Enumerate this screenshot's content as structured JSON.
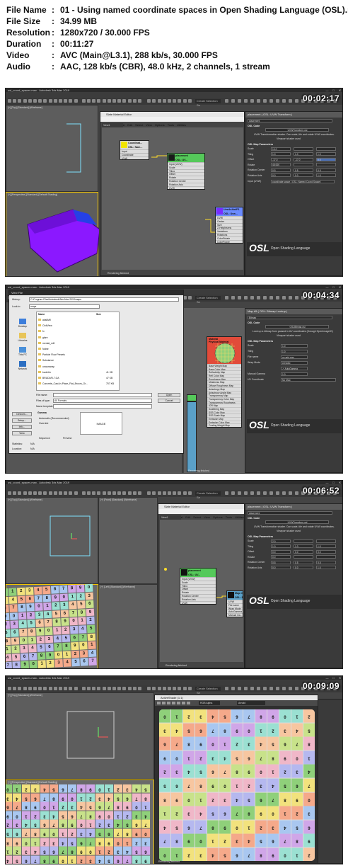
{
  "info": {
    "rows": [
      {
        "key": "File Name",
        "value": "01 - Using named coordinate spaces in Open Shading Language (OSL).mp4"
      },
      {
        "key": "File Size",
        "value": "34.99 MB"
      },
      {
        "key": "Resolution",
        "value": "1280x720 / 30.000 FPS"
      },
      {
        "key": "Duration",
        "value": "00:11:27"
      },
      {
        "key": "Video",
        "value": "AVC (Main@L3.1), 288 kb/s, 30.000 FPS"
      },
      {
        "key": "Audio",
        "value": "AAC, 128 kb/s (CBR), 48.0 kHz, 2 channels, 1 stream"
      }
    ],
    "colon": ":"
  },
  "window_title": "osl_coord_spaces.max - Autodesk 3ds Max 2019",
  "window_buttons": [
    "—",
    "□",
    "✕"
  ],
  "menu": [
    "File",
    "Edit",
    "Tools",
    "Group",
    "Views",
    "Create",
    "Modifiers",
    "Animation",
    "Graph Editors",
    "Rendering",
    "Civil View",
    "Customize",
    "Scripting",
    "Content"
  ],
  "signin": "Sign In",
  "selection_set": "Create Selection Se",
  "branding": {
    "linkedin": "Linked",
    "in": "in",
    "learning": "LEARNING",
    "osl": "OSL",
    "osl_sub": "Open Shading Language"
  },
  "frames": [
    {
      "timestamp": "00:02:17",
      "viewport_labels": [
        "[+] [Top] [Standard] [Wireframe]",
        "[+] [Perspective] [Standard] [Default Shading]"
      ],
      "sme": {
        "title": "Slate Material Editor",
        "menu": [
          "Modes",
          "Material",
          "Edit",
          "Select",
          "View",
          "Options",
          "Tools",
          "Utilities"
        ],
        "view_tab": "View1",
        "status": "Rendering finished",
        "nodes": [
          {
            "title": "Coordinat...\nOSL: Nam...",
            "lines": [
              "Input",
              "Coordinate",
              "UVW"
            ]
          },
          {
            "title": "placement\nOSL: UV...",
            "lines": [
              "Input (UVW)",
              "Scale",
              "Tiling",
              "Offset",
              "Rotate",
              "Rotation Center",
              "Rotation Axis",
              "UVW"
            ]
          },
          {
            "title": "Uvw1nXmlP1\nOSL: Uvw...",
            "lines": [
              "UVW",
              "Center",
              "Size",
              "Z-Heightsens",
              "Variations",
              "Rotations",
              "ColorRotate",
              "ColorPower"
            ]
          }
        ]
      },
      "panel": {
        "header": "placement ( OSL: UVW Transform )",
        "name": "placement",
        "section1": "OSL Code",
        "file": "UVWTransform.osl",
        "desc": "UVW Transformation shader. Can scale, tile and rotate UVW coordinates.",
        "loaded": "Viewport shader used",
        "section2": "OSL Map Parameters",
        "params": [
          {
            "label": "Scale",
            "v": [
              "10.0",
              "",
              ""
            ]
          },
          {
            "label": "Tiling",
            "v": [
              "1.0",
              "1.0",
              "1.0"
            ]
          },
          {
            "label": "Offset",
            "v": [
              "-17.0",
              "-17.0",
              "0.0"
            ]
          },
          {
            "label": "Rotate",
            "v": [
              "45.000",
              "",
              ""
            ]
          },
          {
            "label": "Rotation Center",
            "v": [
              "0.5",
              "0.5",
              "0.5"
            ]
          },
          {
            "label": "Rotation Axis",
            "v": [
              "0.0",
              "0.0",
              "1.0"
            ]
          }
        ],
        "input": "Input (UVW)",
        "input_value": "coordinate space ( OSL: Named Coord Space )"
      }
    },
    {
      "timestamp": "00:04:34",
      "dialog": {
        "title": "View File",
        "history_label": "History:",
        "history_value": "C:\\Program Files\\Autodesk\\3ds Max 2019\\maps",
        "lookin_label": "Look in:",
        "lookin_value": "maps",
        "col_name": "Name",
        "col_size": "Size",
        "files": [
          {
            "n": "adskMtl",
            "s": ""
          },
          {
            "n": "CivilView",
            "s": ""
          },
          {
            "n": "fx",
            "s": ""
          },
          {
            "n": "glare",
            "s": ""
          },
          {
            "n": "mental_mill",
            "s": ""
          },
          {
            "n": "Noise",
            "s": ""
          },
          {
            "n": "Particle Flow Presets",
            "s": ""
          },
          {
            "n": "Substance",
            "s": ""
          },
          {
            "n": "uvwunwrap",
            "s": ""
          },
          {
            "n": "bark.ikh",
            "s": "41 KB"
          },
          {
            "n": "BRUDAFL7.GA",
            "s": "47 KB"
          },
          {
            "n": "Concrete_Cast-In-Place_Flat_Broom_Gr...",
            "s": "757 KB"
          }
        ],
        "sidebar": [
          "Desktop",
          "Libraries",
          "This PC",
          "Network"
        ],
        "file_name_label": "File name:",
        "file_type_label": "Files of type:",
        "file_type_value": "All Formats",
        "template_label": "Name template:",
        "open": "Open",
        "cancel": "Cancel",
        "gamma": "Gamma",
        "gamma_opts": [
          "Automatic (Recommended)",
          "Override"
        ],
        "devices": "Devices...",
        "setup": "Setup...",
        "info_btn": "Info...",
        "view": "View",
        "sequence": "Sequence",
        "preview": "Preview",
        "image": "IMAGE",
        "stats": "Statistics:",
        "stats_v": "N/A",
        "location": "Location:",
        "location_v": "N/A"
      },
      "material": {
        "title": "Material",
        "subtitle": "Physical Material",
        "lines": [
          "Base Weight Map",
          "Base Color Map",
          "Reflectivity Map",
          "Refl Color Map",
          "Roughness Map",
          "Metalness Map",
          "Diffuse Roughness Map",
          "Anisotropy Map",
          "Anisotropy Angle Map",
          "Transparency Map",
          "Transparency Color Map",
          "Transparency Roughness",
          "IOR Map",
          "Scattering Map",
          "SSS Color Map",
          "SSS Scale Map",
          "Emission Map",
          "Emission Color Map",
          "Coating Weight Map"
        ]
      },
      "panel": {
        "header": "Map #5 ( OSL: Bitmap Lookup )",
        "name": "Bitmap",
        "section1": "OSL Code",
        "file": "OSLBitmap.osl",
        "desc": "Look up a bitmap from passed in UV coordinates (through OpenImageIO)",
        "loaded": "Viewport shader used",
        "section2": "OSL Map Parameters",
        "params": [
          {
            "label": "Scale",
            "v": [
              "1.0"
            ]
          },
          {
            "label": "Tiling",
            "v": [
              "1.0"
            ]
          },
          {
            "label": "File name",
            "v": [
              "uv-grid.png"
            ]
          },
          {
            "label": "Wrap Mode",
            "v": [
              "periodic"
            ]
          },
          {
            "label": "",
            "v": [
              "✓ AutoGamma"
            ]
          },
          {
            "label": "Manual Gamma",
            "v": [
              "1.0"
            ]
          },
          {
            "label": "UV Coordinate",
            "v": [
              "No Map"
            ]
          }
        ]
      }
    },
    {
      "timestamp": "00:06:52",
      "viewport_labels": [
        "[+] [Top] [Standard] [Wireframe]",
        "[+] [Front] [Standard] [Wireframe]",
        "[+] [Left] [Standard] [Wireframe]"
      ],
      "sme": {
        "title": "Slate Material Editor",
        "menu": [
          "Modes",
          "Material",
          "Edit",
          "Select",
          "View",
          "Options",
          "Tools",
          "Utilities"
        ],
        "view_tab": "View1",
        "status": "Rendering finished",
        "nodes": [
          {
            "title": "placement\nOSL: UV...",
            "lines": [
              "Input (UVW)",
              "Scale",
              "Tiling",
              "Offset",
              "Rotate",
              "Rotation Center",
              "Rotation Axis",
              "UVW"
            ]
          },
          {
            "title": "Map #5\nOSL: Bit...",
            "lines": [
              "UVW",
              "File name",
              "Wrap Mode",
              "AutoGamma",
              "Manual Ga..."
            ]
          }
        ]
      },
      "panel": {
        "header": "placement ( OSL: UVW Transform )",
        "name": "placement",
        "section1": "OSL Code",
        "file": "UVWTransform.osl",
        "desc": "UVW Transformation shader. Can scale, tile and rotate UVW coordinates.",
        "loaded": "Viewport shader used",
        "section2": "OSL Map Parameters",
        "params": [
          {
            "label": "Scale",
            "v": [
              "2.0",
              "",
              ""
            ]
          },
          {
            "label": "Tiling",
            "v": [
              "1.0",
              "1.0",
              "1.0"
            ]
          },
          {
            "label": "Offset",
            "v": [
              "0.0",
              "0.0",
              "0.0"
            ]
          },
          {
            "label": "Rotate",
            "v": [
              "0.0",
              "",
              ""
            ]
          },
          {
            "label": "Rotation Center",
            "v": [
              "0.5",
              "0.5",
              "0.5"
            ]
          },
          {
            "label": "Rotation Axis",
            "v": [
              "0.0",
              "0.0",
              "1.0"
            ]
          }
        ]
      },
      "grid_digits": "0123456789"
    },
    {
      "timestamp": "00:09:09",
      "viewport_labels": [
        "[+] [Top] [Standard] [Wireframe]",
        "[+] [Perspective] [Standard] [Default Shading]"
      ],
      "activeshade": {
        "title": "ActiveShade (1:1)",
        "channel": "RGB Alpha",
        "renderer": "Arnold"
      },
      "status": "Rendering finished",
      "grid_digits": "0123456789"
    }
  ]
}
